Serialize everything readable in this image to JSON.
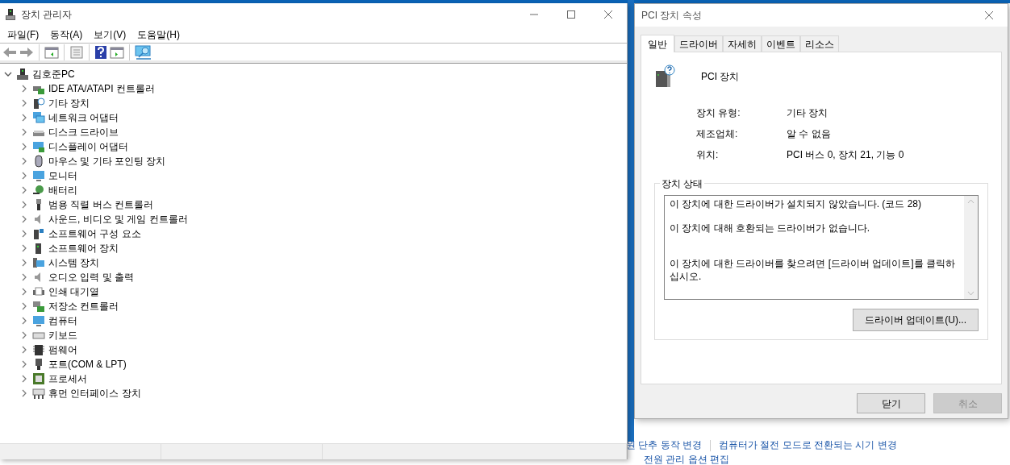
{
  "device_manager": {
    "title": "장치 관리자",
    "menu": [
      "파일(F)",
      "동작(A)",
      "보기(V)",
      "도움말(H)"
    ],
    "tree": {
      "label": "김호준PC",
      "expanded": true,
      "children": [
        {
          "label": "IDE ATA/ATAPI 컨트롤러",
          "expanded": false
        },
        {
          "label": "기타 장치",
          "expanded": false
        },
        {
          "label": "네트워크 어댑터",
          "expanded": false
        },
        {
          "label": "디스크 드라이브",
          "expanded": false
        },
        {
          "label": "디스플레이 어댑터",
          "expanded": false
        },
        {
          "label": "마우스 및 기타 포인팅 장치",
          "expanded": false
        },
        {
          "label": "모니터",
          "expanded": false
        },
        {
          "label": "배터리",
          "expanded": false
        },
        {
          "label": "범용 직렬 버스 컨트롤러",
          "expanded": false
        },
        {
          "label": "사운드, 비디오 및 게임 컨트롤러",
          "expanded": false
        },
        {
          "label": "소프트웨어 구성 요소",
          "expanded": false
        },
        {
          "label": "소프트웨어 장치",
          "expanded": false
        },
        {
          "label": "시스템 장치",
          "expanded": false
        },
        {
          "label": "오디오 입력 및 출력",
          "expanded": false
        },
        {
          "label": "인쇄 대기열",
          "expanded": false
        },
        {
          "label": "저장소 컨트롤러",
          "expanded": false
        },
        {
          "label": "컴퓨터",
          "expanded": false
        },
        {
          "label": "키보드",
          "expanded": false
        },
        {
          "label": "펌웨어",
          "expanded": false
        },
        {
          "label": "포트(COM & LPT)",
          "expanded": false
        },
        {
          "label": "프로세서",
          "expanded": false
        },
        {
          "label": "휴먼 인터페이스 장치",
          "expanded": false
        }
      ]
    }
  },
  "properties_dialog": {
    "title": "PCI 장치 속성",
    "tabs": [
      {
        "label": "일반",
        "selected": true
      },
      {
        "label": "드라이버",
        "selected": false
      },
      {
        "label": "자세히",
        "selected": false
      },
      {
        "label": "이벤트",
        "selected": false
      },
      {
        "label": "리소스",
        "selected": false
      }
    ],
    "device_name": "PCI 장치",
    "fields": [
      {
        "label": "장치 유형:",
        "value": "기타 장치"
      },
      {
        "label": "제조업체:",
        "value": "알 수 없음"
      },
      {
        "label": "위치:",
        "value": "PCI 버스 0, 장치 21, 기능 0"
      }
    ],
    "status": {
      "title": "장치 상태",
      "lines": [
        "이 장치에 대한 드라이버가 설치되지 않았습니다. (코드 28)",
        "이 장치에 대해 호환되는 드라이버가 없습니다.",
        "이 장치에 대한 드라이버를 찾으려면 [드라이버 업데이트]를 클릭하십시오."
      ],
      "button": "드라이버 업데이트(U)..."
    },
    "buttons": [
      {
        "label": "닫기",
        "disabled": false
      },
      {
        "label": "취소",
        "disabled": true
      }
    ]
  },
  "background_links": [
    "원 단추 동작 변경",
    "컴퓨터가 절전 모드로 전환되는 시기 변경",
    "전원 관리 옵션 편집"
  ]
}
